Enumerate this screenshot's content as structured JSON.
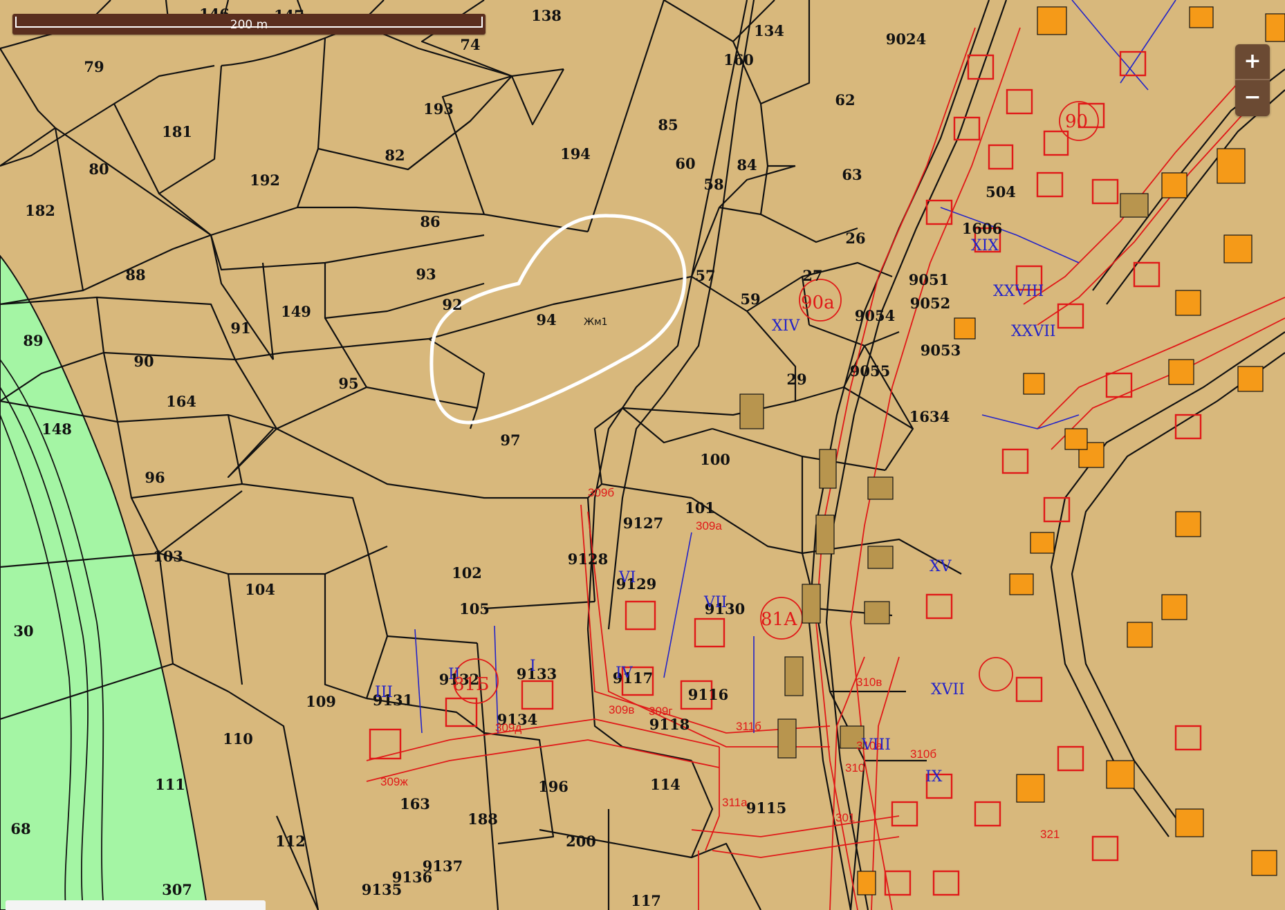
{
  "scale_bar": {
    "label": "200 m"
  },
  "zoom": {
    "in_label": "+",
    "out_label": "−"
  },
  "colors": {
    "land": "#d8b87c",
    "green_zone": "#a4f5a4",
    "parcel_line": "#111111",
    "red_line": "#e01818",
    "blue_line": "#2323c8",
    "building_orange": "#f59a18",
    "highlight_stroke": "#ffffff"
  },
  "parcels": [
    "79",
    "74",
    "138",
    "134",
    "160",
    "9024",
    "62",
    "146",
    "147",
    "193",
    "181",
    "80",
    "192",
    "182",
    "82",
    "194",
    "85",
    "60",
    "84",
    "58",
    "63",
    "86",
    "88",
    "93",
    "92",
    "149",
    "91",
    "94",
    "57",
    "59",
    "27",
    "26",
    "89",
    "90",
    "164",
    "95",
    "148",
    "97",
    "96",
    "100",
    "101",
    "103",
    "104",
    "102",
    "105",
    "9128",
    "9127",
    "9129",
    "9130",
    "30",
    "109",
    "110",
    "9131",
    "9132",
    "9133",
    "9117",
    "9116",
    "9134",
    "9118",
    "111",
    "163",
    "188",
    "196",
    "114",
    "68",
    "112",
    "200",
    "307",
    "9135",
    "9136",
    "9137",
    "117",
    "9115",
    "29",
    "9055",
    "1634",
    "9051",
    "9052",
    "9054",
    "9053",
    "1606",
    "504"
  ],
  "zone_code": "Жм1",
  "red_labels": [
    "309б",
    "309а",
    "309в",
    "309г",
    "309д",
    "309ж",
    "311б",
    "310а",
    "310б",
    "310в",
    "311а",
    "310",
    "321",
    "301"
  ],
  "blue_labels": [
    "VI",
    "VII",
    "IV",
    "III",
    "II",
    "I",
    "XIV",
    "IX",
    "VIII",
    "XV",
    "XVII",
    "XIX",
    "XXVIII",
    "XXVII"
  ],
  "block_labels": [
    "90а",
    "81А",
    "90",
    "81Б"
  ]
}
